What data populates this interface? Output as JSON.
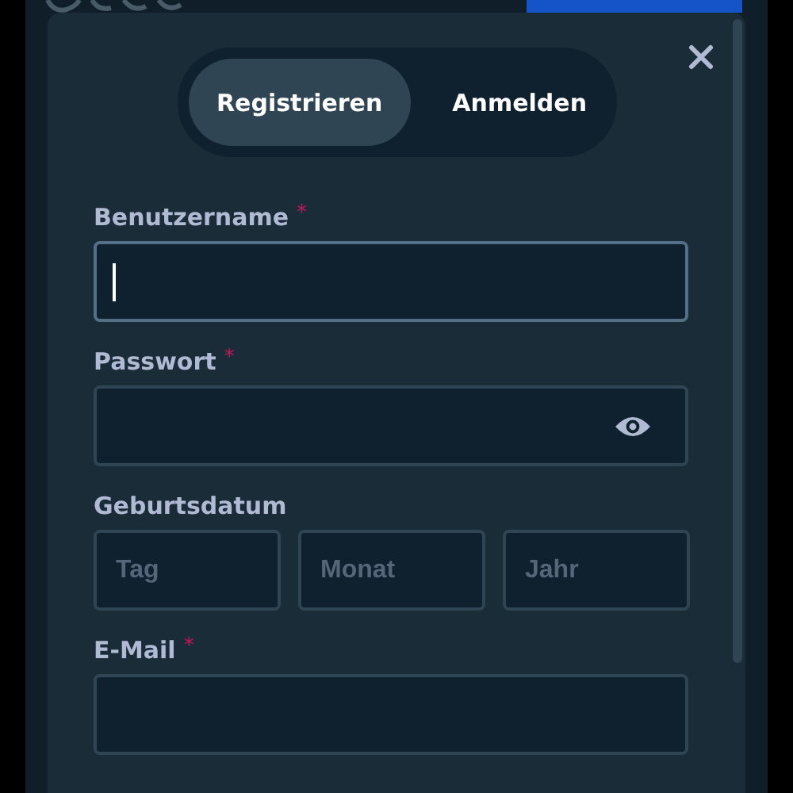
{
  "tabs": [
    {
      "label": "Registrieren",
      "selected": true
    },
    {
      "label": "Anmelden",
      "selected": false
    }
  ],
  "fields": [
    {
      "kind": "text",
      "label": "Benutzername",
      "required_mark": "*",
      "focused": true
    },
    {
      "kind": "password",
      "label": "Passwort",
      "required_mark": "*",
      "focused": false
    },
    {
      "kind": "date",
      "label": "Geburtsdatum",
      "parts": [
        {
          "placeholder": "Tag"
        },
        {
          "placeholder": "Monat"
        },
        {
          "placeholder": "Jahr"
        }
      ]
    },
    {
      "kind": "text",
      "label": "E-Mail",
      "required_mark": "*",
      "focused": false
    }
  ]
}
